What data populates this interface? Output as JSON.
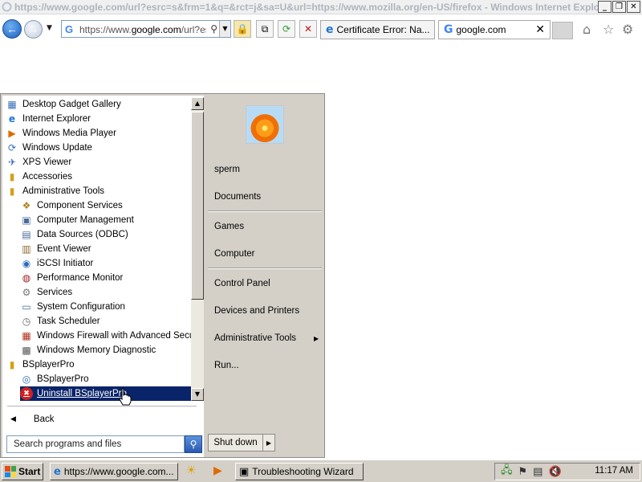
{
  "browser": {
    "title": "https://www.google.com/url?esrc=s&frm=1&q=&rct=j&sa=U&url=https://www.mozilla.org/en-US/firefox - Windows Internet Explorer",
    "address_prefix": "https://www.",
    "address_domain": "google.com",
    "address_suffix": "/url?es",
    "tabs": [
      {
        "label": "Certificate Error: Na..."
      },
      {
        "label": "google.com",
        "close": "✕"
      }
    ],
    "icons": [
      "home-icon",
      "favorites-star-icon",
      "tools-gear-icon"
    ]
  },
  "start_menu": {
    "programs": [
      {
        "label": "Desktop Gadget Gallery",
        "icon": "gadget-icon",
        "indent": 0
      },
      {
        "label": "Internet Explorer",
        "icon": "ie-icon",
        "indent": 0
      },
      {
        "label": "Windows Media Player",
        "icon": "media-player-icon",
        "indent": 0
      },
      {
        "label": "Windows Update",
        "icon": "windows-update-icon",
        "indent": 0
      },
      {
        "label": "XPS Viewer",
        "icon": "xps-icon",
        "indent": 0
      },
      {
        "label": "Accessories",
        "icon": "folder-icon",
        "indent": 0
      },
      {
        "label": "Administrative Tools",
        "icon": "folder-icon",
        "indent": 0
      },
      {
        "label": "Component Services",
        "icon": "component-services-icon",
        "indent": 1
      },
      {
        "label": "Computer Management",
        "icon": "computer-management-icon",
        "indent": 1
      },
      {
        "label": "Data Sources (ODBC)",
        "icon": "data-sources-icon",
        "indent": 1
      },
      {
        "label": "Event Viewer",
        "icon": "event-viewer-icon",
        "indent": 1
      },
      {
        "label": "iSCSI Initiator",
        "icon": "iscsi-icon",
        "indent": 1
      },
      {
        "label": "Performance Monitor",
        "icon": "performance-monitor-icon",
        "indent": 1
      },
      {
        "label": "Services",
        "icon": "services-gear-icon",
        "indent": 1
      },
      {
        "label": "System Configuration",
        "icon": "system-config-icon",
        "indent": 1
      },
      {
        "label": "Task Scheduler",
        "icon": "clock-icon",
        "indent": 1
      },
      {
        "label": "Windows Firewall with Advanced Securit",
        "icon": "firewall-icon",
        "indent": 1
      },
      {
        "label": "Windows Memory Diagnostic",
        "icon": "memory-diagnostic-icon",
        "indent": 1
      },
      {
        "label": "BSplayerPro",
        "icon": "folder-icon",
        "indent": 0
      },
      {
        "label": "BSplayerPro",
        "icon": "bsplayer-icon",
        "indent": 1
      },
      {
        "label": "Uninstall BSplayerPro",
        "icon": "uninstall-icon",
        "indent": 1,
        "selected": true
      }
    ],
    "back_label": "Back",
    "search_placeholder": "Search programs and files",
    "right_items": {
      "user": "sperm",
      "documents": "Documents",
      "games": "Games",
      "computer": "Computer",
      "control_panel": "Control Panel",
      "devices": "Devices and Printers",
      "admin_tools": "Administrative Tools",
      "run": "Run..."
    },
    "shutdown_label": "Shut down"
  },
  "taskbar": {
    "start_label": "Start",
    "tasks": [
      {
        "label": "https://www.google.com...",
        "icon": "ie-icon"
      },
      {
        "label": "Troubleshooting Wizard",
        "icon": "wizard-icon"
      }
    ],
    "clock": "11:17 AM"
  },
  "colors": {
    "selection": "#0a246a",
    "chrome": "#d4d0c8",
    "ie_blue": "#1d74d3"
  }
}
